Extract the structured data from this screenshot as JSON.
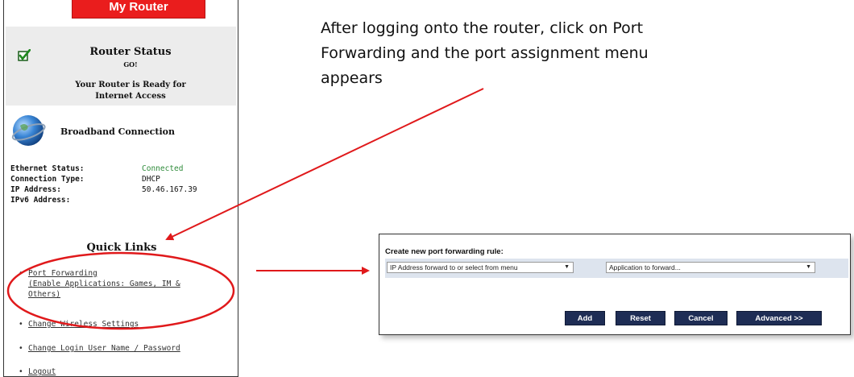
{
  "router": {
    "header": "My Router",
    "status_title": "Router Status",
    "status_sub": "GO!",
    "status_msg_1": "Your Router is Ready for",
    "status_msg_2": "Internet Access",
    "broadband_title": "Broadband Connection",
    "info": [
      {
        "label": "Ethernet Status:",
        "value": "Connected",
        "color": "#2e8b3a"
      },
      {
        "label": "Connection Type:",
        "value": "DHCP"
      },
      {
        "label": "IP Address:",
        "value": "50.46.167.39"
      },
      {
        "label": "IPv6 Address:",
        "value": ""
      }
    ],
    "quick_links_title": "Quick Links",
    "quick_links": [
      {
        "line1": "Port Forwarding",
        "line2": "(Enable Applications: Games, IM &",
        "line3": "Others)"
      },
      {
        "line1": "Change Wireless Settings"
      },
      {
        "line1": "Change Login User Name / Password"
      },
      {
        "line1": "Logout"
      }
    ],
    "bullet": "•"
  },
  "instruction": {
    "line1": "After logging onto the router, click on Port",
    "line2": "Forwarding and the port assignment menu",
    "line3": "appears"
  },
  "port_forwarding": {
    "title": "Create new port forwarding rule:",
    "ip_select_value": "IP Address forward to or select from menu",
    "app_select_value": "Application to forward...",
    "dropdown_arrow": "▼",
    "buttons": {
      "add": "Add",
      "reset": "Reset",
      "cancel": "Cancel",
      "advanced": "Advanced >>"
    }
  },
  "colors": {
    "brand_red": "#ea1d1d",
    "annotation_red": "#e0191b",
    "button_navy": "#1e2d55",
    "connected_green": "#2e8b3a"
  }
}
